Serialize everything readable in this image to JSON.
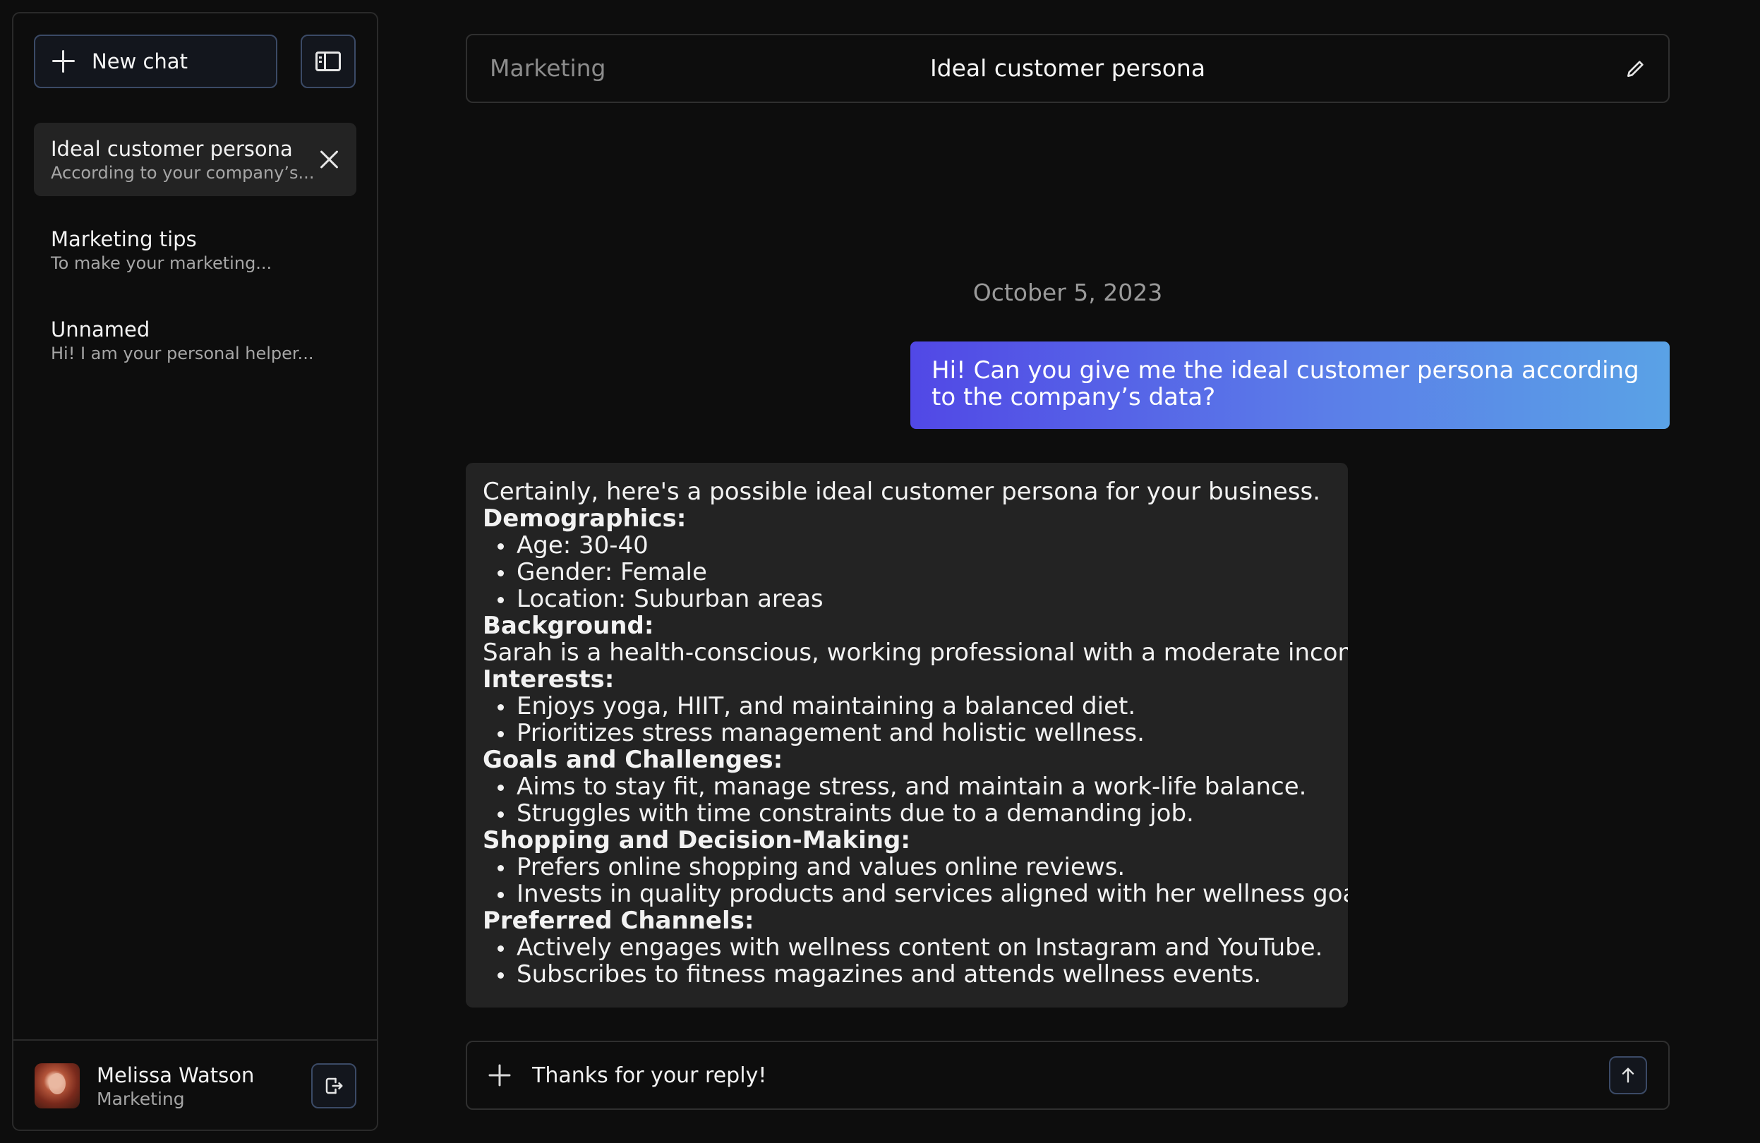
{
  "sidebar": {
    "new_chat_label": "New chat",
    "chats": [
      {
        "title": "Ideal customer persona",
        "preview": "According to your company’s..."
      },
      {
        "title": "Marketing tips",
        "preview": "To make your marketing..."
      },
      {
        "title": "Unnamed",
        "preview": "Hi! I am your personal helper..."
      }
    ],
    "user": {
      "name": "Melissa Watson",
      "role": "Marketing"
    }
  },
  "header": {
    "category": "Marketing",
    "title": "Ideal customer persona"
  },
  "conversation": {
    "date": "October 5, 2023",
    "user_message": "Hi! Can you give me the ideal customer persona according to the company’s data?",
    "ai_message": {
      "intro": "Certainly, here's a possible ideal customer persona for your business.",
      "demographics_heading": "Demographics:",
      "demographics": [
        "Age: 30-40",
        "Gender: Female",
        "Location: Suburban areas"
      ],
      "background_heading": "Background:",
      "background": "Sarah is a health-conscious, working professional with a moderate income.",
      "interests_heading": "Interests:",
      "interests": [
        "Enjoys yoga, HIIT, and maintaining a balanced diet.",
        "Prioritizes stress management and holistic wellness."
      ],
      "goals_heading": "Goals and Challenges:",
      "goals": [
        "Aims to stay fit, manage stress, and maintain a work-life balance.",
        "Struggles with time constraints due to a demanding job."
      ],
      "shopping_heading": "Shopping and Decision-Making:",
      "shopping": [
        "Prefers online shopping and values online reviews.",
        "Invests in quality products and services aligned with her wellness goals."
      ],
      "channels_heading": "Preferred Channels:",
      "channels": [
        "Actively engages with wellness content on Instagram and YouTube.",
        "Subscribes to fitness magazines and attends wellness events."
      ]
    }
  },
  "composer": {
    "value": "Thanks for your reply!"
  },
  "colors": {
    "background": "#0d0d0d",
    "panel": "#232323",
    "accent_border": "#3b4a66",
    "user_bubble_start": "#5148e6",
    "user_bubble_end": "#5aa2e6"
  },
  "icons": [
    "plus-icon",
    "sidebar-panel-icon",
    "close-icon",
    "logout-icon",
    "pencil-icon",
    "arrow-up-icon"
  ]
}
